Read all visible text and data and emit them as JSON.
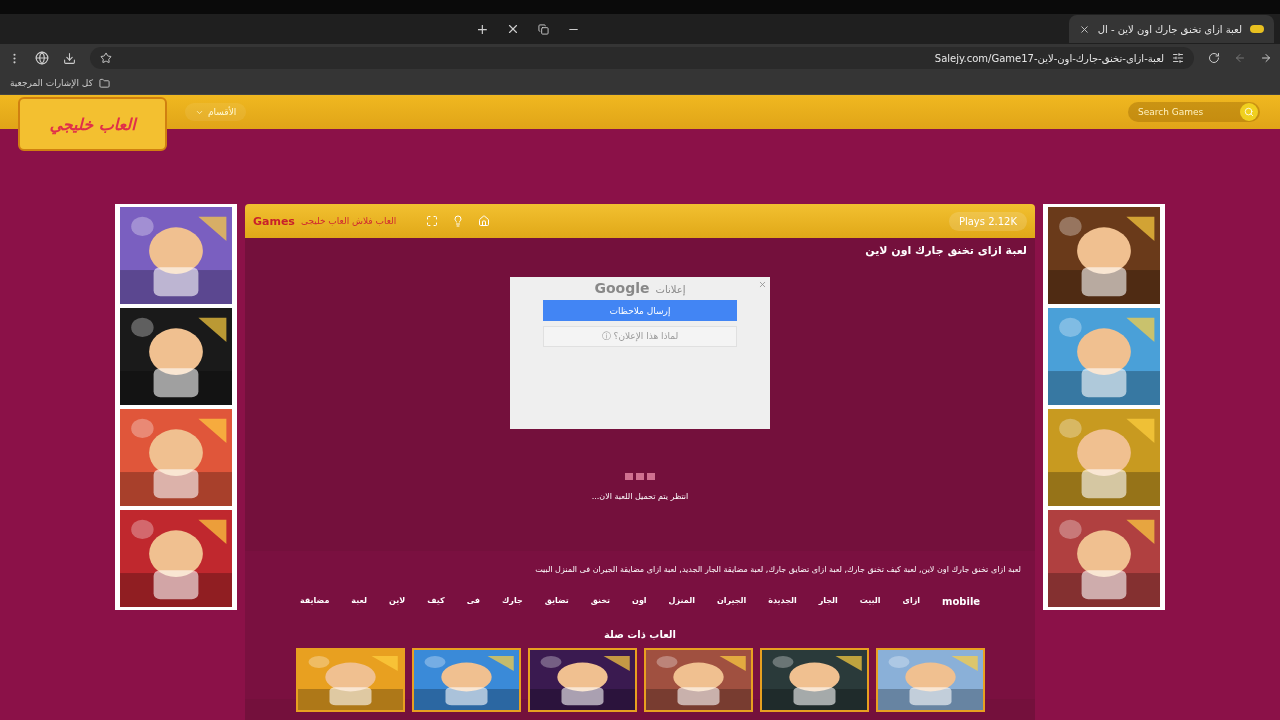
{
  "browser": {
    "tab": {
      "title": "لعبة ازاى تخنق جارك اون لاين - ال",
      "selected": true
    },
    "new_tab": "+",
    "address": "Salejy.com/Game17-لعبة-ازاى-تخنق-جارك-اون-لاين",
    "bookmarks": "كل الإشارات المرجعية"
  },
  "header": {
    "logo": "العاب خليجي",
    "menu": "الأقسام",
    "search": {
      "placeholder": "Search Games"
    }
  },
  "game": {
    "brand": "Games",
    "site": "العاب فلاش العاب خليجى",
    "plays": "Plays 2.12K",
    "title": "لعبة ازاى تخنق جارك اون لاين",
    "ad": {
      "label": "إعلانات",
      "provider": "Google",
      "feedback": "إرسال ملاحظات",
      "why": "لماذا هذا الإعلان؟",
      "info": "ⓘ"
    },
    "loading": "انتظر يتم تحميل اللعبة الان...",
    "description": "لعبة ازاى تخنق جارك اون لاين, لعبة كيف تخنق جارك, لعبة ازاى تضايق جارك, لعبة مضايقة الجار الجديد, لعبة ازاى مضايقة الجيران فى المنزل البيت",
    "tags": [
      "mobile",
      "ازاى",
      "البيت",
      "الجار",
      "الجديدة",
      "الجيران",
      "المنزل",
      "اون",
      "تخنق",
      "تضايق",
      "جارك",
      "فى",
      "كيف",
      "لاين",
      "لعبة",
      "مضايقة"
    ],
    "related_title": "العاب ذات صلة"
  }
}
